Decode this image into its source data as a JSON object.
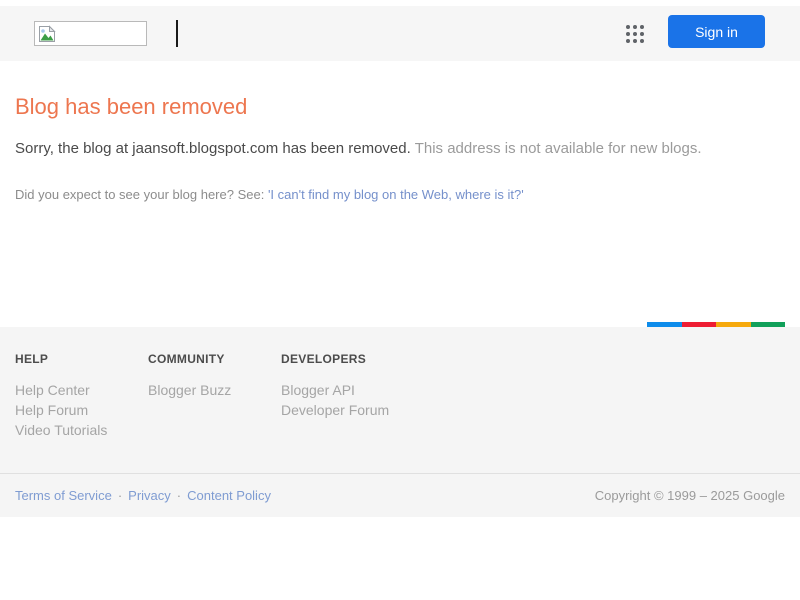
{
  "header": {
    "sign_in_label": "Sign in"
  },
  "main": {
    "title": "Blog has been removed",
    "message_strong": "Sorry, the blog at jaansoft.blogspot.com has been removed.",
    "message_rest": " This address is not available for new blogs.",
    "expect_text": "Did you expect to see your blog here? See: ",
    "expect_link": "'I can't find my blog on the Web, where is it?'"
  },
  "footer": {
    "columns": [
      {
        "heading": "HELP",
        "links": [
          "Help Center",
          "Help Forum",
          "Video Tutorials"
        ]
      },
      {
        "heading": "COMMUNITY",
        "links": [
          "Blogger Buzz"
        ]
      },
      {
        "heading": "DEVELOPERS",
        "links": [
          "Blogger API",
          "Developer Forum"
        ]
      }
    ],
    "legal_links": [
      "Terms of Service",
      "Privacy",
      "Content Policy"
    ],
    "separator": "·",
    "copyright": "Copyright © 1999 – 2025 Google"
  },
  "icons": {
    "apps_grid": "grid-of-9-dots",
    "broken_image": "broken-image-placeholder",
    "text_cursor": "vertical-bar-cursor"
  },
  "colors": {
    "accent_blue": "#1a73e8",
    "title_orange": "#ed764f",
    "header_bg": "#f6f6f6",
    "footer_bg": "#f5f5f5",
    "stripe": [
      "#0d8ceb",
      "#ee1d33",
      "#f6a90c",
      "#11a05a"
    ]
  }
}
